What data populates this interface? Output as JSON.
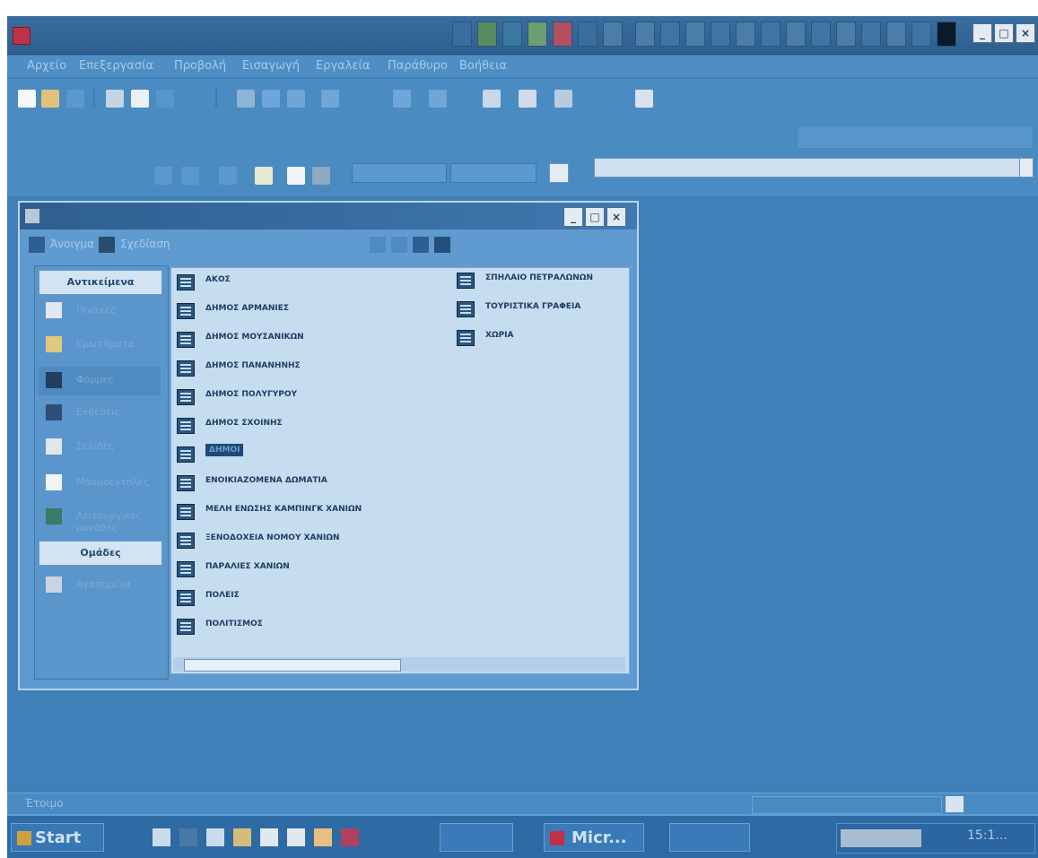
{
  "app": {
    "title": "",
    "accent": "#3f80b8"
  },
  "menubar": {
    "items": [
      "Αρχείο",
      "Επεξεργασία",
      "Προβολή",
      "Εισαγωγή",
      "Εργαλεία",
      "Παράθυρο",
      "Βοήθεια"
    ]
  },
  "db_window": {
    "title": "",
    "open_label": "Άνοιγμα",
    "design_label": "Σχεδίαση",
    "objects_header": "Αντικείμενα",
    "groups_header": "Ομάδες",
    "object_types": [
      "Πίνακες",
      "Ερωτήματα",
      "Φόρμες",
      "Εκθέσεις",
      "Σελίδες",
      "Μακροεντολές",
      "Λειτουργικές μονάδες"
    ],
    "group_items": [
      "Αγαπημένα"
    ],
    "list_col1": [
      "ΑΚΟΣ",
      "ΔΗΜΟΣ ΑΡΜΑΝΙΕΣ",
      "ΔΗΜΟΣ ΜΟΥΣΑΝΙΚΩΝ",
      "ΔΗΜΟΣ ΠΑΝΑΝΗΝΗΣ",
      "ΔΗΜΟΣ ΠΟΛΥΓΥΡΟΥ",
      "ΔΗΜΟΣ ΣΧΟΙΝΗΣ",
      "ΔΗΜΟΙ",
      "ΕΝΟΙΚΙΑΖΟΜΕΝΑ ΔΩΜΑΤΙΑ",
      "ΜΕΛΗ ΕΝΩΣΗΣ ΚΑΜΠΙΝΓΚ ΧΑΝΙΩΝ",
      "ΞΕΝΟΔΟΧΕΙΑ ΝΟΜΟΥ ΧΑΝΙΩΝ",
      "ΠΑΡΑΛΙΕΣ ΧΑΝΙΩΝ",
      "ΠΟΛΕΙΣ",
      "ΠΟΛΙΤΙΣΜΟΣ"
    ],
    "list_col2": [
      "ΣΠΗΛΑΙΟ ΠΕΤΡΑΛΩΝΩΝ",
      "ΤΟΥΡΙΣΤΙΚΑ ΓΡΑΦΕΙΑ",
      "ΧΩΡΙΑ"
    ],
    "selected_item": "ΔΗΜΟΙ"
  },
  "statusbar": {
    "text": "Έτοιμο"
  },
  "taskbar": {
    "start_label": "Start",
    "active_task_label": "Micr...",
    "clock": "15:1..."
  }
}
